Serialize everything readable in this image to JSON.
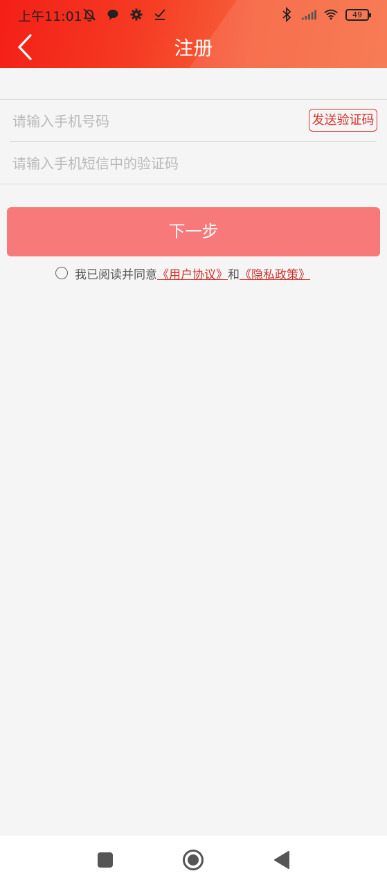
{
  "status_bar": {
    "time": "上午11:01",
    "battery": "49",
    "icons_left": [
      "mute-bell-icon",
      "chat-bubble-icon",
      "gear-icon",
      "download-check-icon"
    ],
    "icons_right": [
      "bluetooth-icon",
      "signal-icon",
      "wifi-icon",
      "battery-icon"
    ]
  },
  "header": {
    "title": "注册",
    "back_icon": "chevron-left-icon",
    "gradient": [
      "#f41f17",
      "#f76d42"
    ]
  },
  "form": {
    "phone_placeholder": "请输入手机号码",
    "phone_value": "",
    "code_placeholder": "请输入手机短信中的验证码",
    "code_value": "",
    "send_code_label": "发送验证码"
  },
  "next_button": {
    "label": "下一步",
    "color": "#f7797a"
  },
  "agreement": {
    "prefix": "我已阅读并同意",
    "user_agreement": "《用户协议》",
    "conjunction": "和",
    "privacy_policy": "《隐私政策》",
    "checked": false,
    "link_color": "#d0302a"
  },
  "system_nav": {
    "buttons": [
      "recent-apps-icon",
      "home-icon",
      "back-triangle-icon"
    ]
  }
}
